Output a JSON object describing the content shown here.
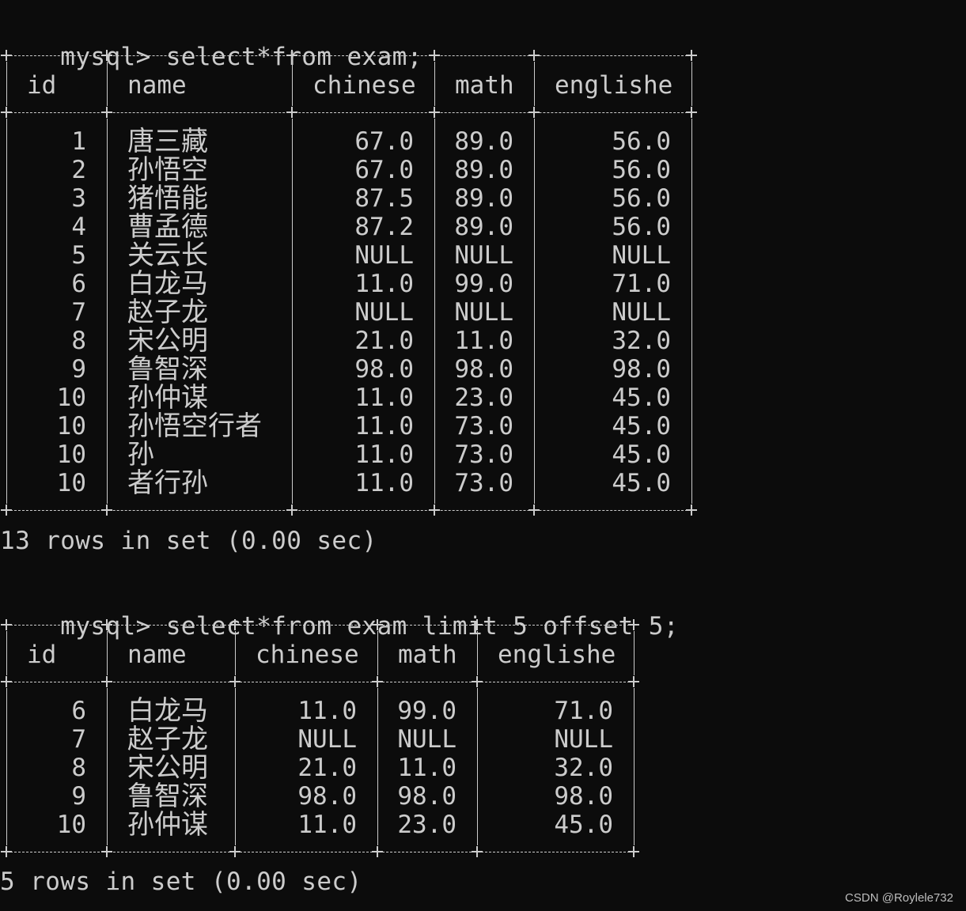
{
  "terminal": {
    "prompt": "mysql>",
    "query1": {
      "command": " select*from exam;",
      "columns": [
        "id",
        "name",
        "chinese",
        "math",
        "englishe"
      ],
      "rows": [
        [
          "1",
          "唐三藏",
          "67.0",
          "89.0",
          "56.0"
        ],
        [
          "2",
          "孙悟空",
          "67.0",
          "89.0",
          "56.0"
        ],
        [
          "3",
          "猪悟能",
          "87.5",
          "89.0",
          "56.0"
        ],
        [
          "4",
          "曹孟德",
          "87.2",
          "89.0",
          "56.0"
        ],
        [
          "5",
          "关云长",
          "NULL",
          "NULL",
          "NULL"
        ],
        [
          "6",
          "白龙马",
          "11.0",
          "99.0",
          "71.0"
        ],
        [
          "7",
          "赵子龙",
          "NULL",
          "NULL",
          "NULL"
        ],
        [
          "8",
          "宋公明",
          "21.0",
          "11.0",
          "32.0"
        ],
        [
          "9",
          "鲁智深",
          "98.0",
          "98.0",
          "98.0"
        ],
        [
          "10",
          "孙仲谋",
          "11.0",
          "23.0",
          "45.0"
        ],
        [
          "10",
          "孙悟空行者",
          "11.0",
          "73.0",
          "45.0"
        ],
        [
          "10",
          "孙",
          "11.0",
          "73.0",
          "45.0"
        ],
        [
          "10",
          "者行孙",
          "11.0",
          "73.0",
          "45.0"
        ]
      ],
      "summary": "13 rows in set (0.00 sec)"
    },
    "query2": {
      "command": " select*from exam limit 5 offset 5;",
      "columns": [
        "id",
        "name",
        "chinese",
        "math",
        "englishe"
      ],
      "rows": [
        [
          "6",
          "白龙马",
          "11.0",
          "99.0",
          "71.0"
        ],
        [
          "7",
          "赵子龙",
          "NULL",
          "NULL",
          "NULL"
        ],
        [
          "8",
          "宋公明",
          "21.0",
          "11.0",
          "32.0"
        ],
        [
          "9",
          "鲁智深",
          "98.0",
          "98.0",
          "98.0"
        ],
        [
          "10",
          "孙仲谋",
          "11.0",
          "23.0",
          "45.0"
        ]
      ],
      "summary": "5 rows in set (0.00 sec)"
    }
  },
  "watermark": "CSDN @Roylele732",
  "colors": {
    "background": "#0c0c0c",
    "text": "#cccccc"
  }
}
